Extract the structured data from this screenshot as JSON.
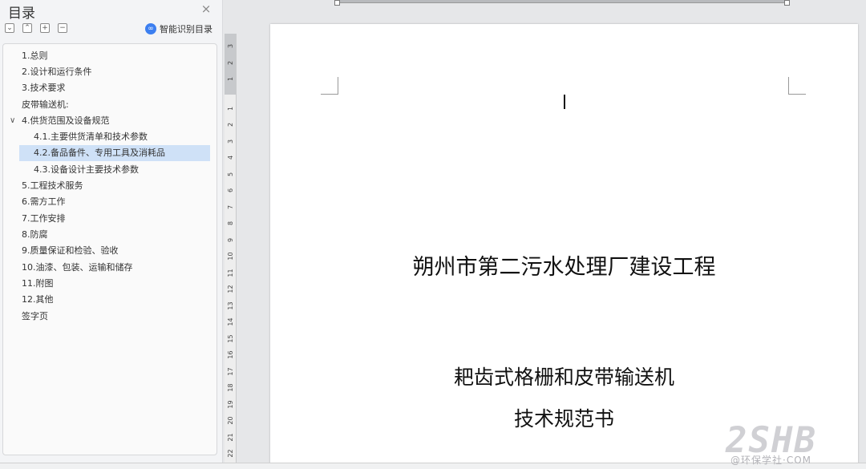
{
  "toc": {
    "title": "目录",
    "close_glyph": "×",
    "toolbar": {
      "collapse_all": "⌄",
      "expand_all": "⌃",
      "add": "+",
      "remove": "−"
    },
    "smart_toc_icon": "link-icon",
    "smart_toc_label": "智能识别目录",
    "items": [
      {
        "label": "1.总则",
        "level": 1
      },
      {
        "label": "2.设计和运行条件",
        "level": 1
      },
      {
        "label": "3.技术要求",
        "level": 1
      },
      {
        "label": "皮带输送机:",
        "level": 1
      },
      {
        "label": "4.供货范围及设备规范",
        "level": 1,
        "expanded": true
      },
      {
        "label": "4.1.主要供货清单和技术参数",
        "level": 2
      },
      {
        "label": "4.2.备品备件、专用工具及消耗品",
        "level": 2,
        "selected": true
      },
      {
        "label": "4.3.设备设计主要技术参数",
        "level": 2
      },
      {
        "label": "5.工程技术服务",
        "level": 1
      },
      {
        "label": "6.需方工作",
        "level": 1
      },
      {
        "label": "7.工作安排",
        "level": 1
      },
      {
        "label": "8.防腐",
        "level": 1
      },
      {
        "label": "9.质量保证和检验、验收",
        "level": 1
      },
      {
        "label": "10.油漆、包装、运输和储存",
        "level": 1
      },
      {
        "label": "11.附图",
        "level": 1
      },
      {
        "label": "12.其他",
        "level": 1
      },
      {
        "label": "签字页",
        "level": 1
      }
    ],
    "expander_glyph": "∨"
  },
  "ruler": {
    "labels": [
      "3",
      "2",
      "1",
      "1",
      "2",
      "3",
      "4",
      "5",
      "6",
      "7",
      "8",
      "9",
      "10",
      "11",
      "12",
      "13",
      "14",
      "15",
      "16",
      "17",
      "18",
      "19",
      "20",
      "21",
      "22"
    ]
  },
  "document": {
    "title_main": "朔州市第二污水处理厂建设工程",
    "title_sub": "耙齿式格栅和皮带输送机",
    "title_spec": "技术规范书"
  },
  "watermark": {
    "logo": "2SHB",
    "text": "@环保学社·COM"
  },
  "colors": {
    "selection": "#cfe1f7",
    "accent": "#3c7ff0"
  }
}
